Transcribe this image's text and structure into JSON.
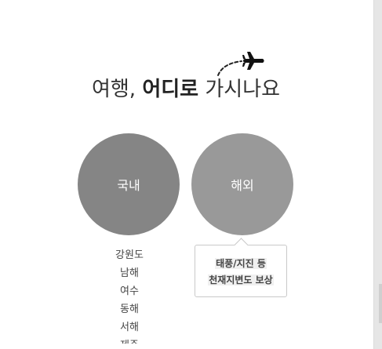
{
  "title": {
    "prefix": "여행, ",
    "emphasis": "어디로",
    "suffix": " 가시나요"
  },
  "choices": {
    "domestic_label": "국내",
    "overseas_label": "해외"
  },
  "regions": [
    "강원도",
    "남해",
    "여수",
    "동해",
    "서해",
    "제주"
  ],
  "tooltip": {
    "line1": "태풍/지진 등",
    "line2": "천재지변도 보상"
  },
  "icons": {
    "plane": "airplane-icon"
  },
  "colors": {
    "domestic_circle": "#858585",
    "overseas_circle": "#999999",
    "title_text": "#333333"
  }
}
